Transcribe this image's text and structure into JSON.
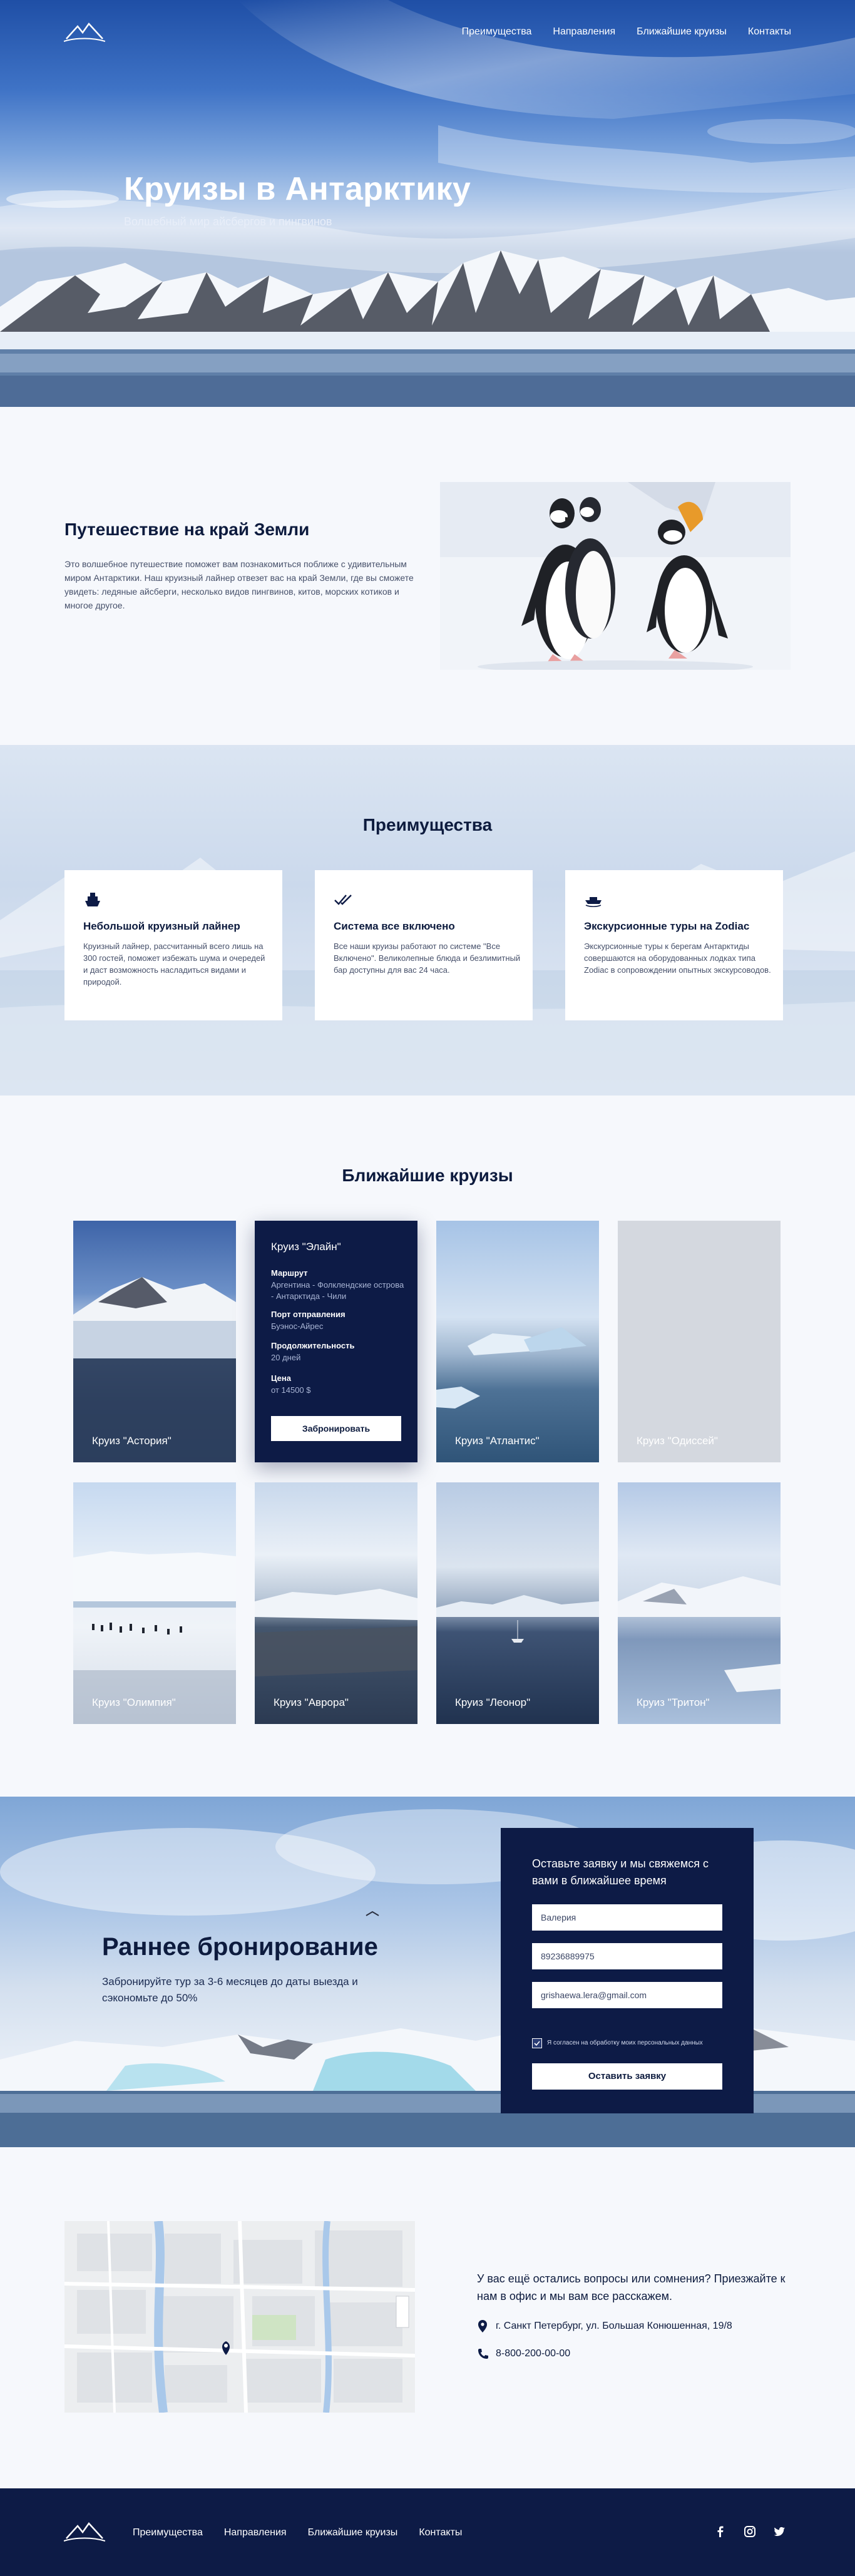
{
  "nav": {
    "items": [
      "Преимущества",
      "Направления",
      "Ближайшие круизы",
      "Контакты"
    ]
  },
  "hero": {
    "title": "Круизы в Антарктику",
    "subtitle": "Волшебный мир айсбергов и пингвинов"
  },
  "intro": {
    "title": "Путешествие на край Земли",
    "text": "Это волшебное путешествие поможет вам познакомиться поближе с удивительным миром Антарктики. Наш круизный лайнер отвезет вас на край Земли, где вы сможете увидеть: ледяные айсберги, несколько видов пингвинов, китов, морских котиков и многое другое."
  },
  "benefits": {
    "title": "Преимущества",
    "items": [
      {
        "icon": "ship-icon",
        "title": "Небольшой круизный лайнер",
        "text": "Круизный лайнер, рассчитанный всего лишь на 300 гостей, поможет избежать шума и очередей и даст возможность насладиться видами и природой."
      },
      {
        "icon": "double-check-icon",
        "title": "Система все включено",
        "text": "Все наши круизы работают по системе \"Все Включено\". Великолепные блюда и безлимитный бар доступны для вас 24 часа."
      },
      {
        "icon": "boat-icon",
        "title": "Экскурсионные туры на Zodiac",
        "text": "Экскурсионные туры к берегам Антарктиды совершаются на оборудованных лодках типа Zodiac в сопровождении опытных экскурсоводов."
      }
    ]
  },
  "cruises": {
    "title": "Ближайшие круизы",
    "active": {
      "name": "Круиз \"Элайн\"",
      "route_label": "Маршрут",
      "route": "Аргентина - Фолклендские острова - Антарктида - Чили",
      "port_label": "Порт отправления",
      "port": "Буэнос-Айрес",
      "duration_label": "Продолжительность",
      "duration": "20 дней",
      "price_label": "Цена",
      "price": "от 14500 $",
      "button": "Забронировать"
    },
    "cards": [
      "Круиз \"Астория\"",
      "Круиз \"Атлантис\"",
      "Круиз \"Одиссей\"",
      "Круиз \"Олимпия\"",
      "Круиз \"Аврора\"",
      "Круиз \"Леонор\"",
      "Круиз \"Тритон\""
    ]
  },
  "booking": {
    "title": "Раннее бронирование",
    "subtitle": "Забронируйте тур за 3-6 месяцев до даты выезда и сэкономьте до 50%",
    "form_title": "Оставьте заявку и мы свяжемся с вами в ближайшее время",
    "name_value": "Валерия",
    "phone_value": "89236889975",
    "email_value": "grishaewa.lera@gmail.com",
    "consent": "Я согласен на обработку моих персональных данных",
    "submit": "Оставить заявку"
  },
  "contacts": {
    "question": "У вас ещё остались вопросы или сомнения? Приезжайте к нам в офис и мы вам все расскажем.",
    "address": "г. Санкт Петербург, ул. Большая Конюшенная, 19/8",
    "phone": "8-800-200-00-00"
  },
  "footer": {
    "items": [
      "Преимущества",
      "Направления",
      "Ближайшие круизы",
      "Контакты"
    ],
    "social": [
      "facebook-icon",
      "instagram-icon",
      "twitter-icon"
    ]
  },
  "colors": {
    "navy": "#0d1b46",
    "bg": "#f6f8fc",
    "text": "#0d1b3e"
  }
}
